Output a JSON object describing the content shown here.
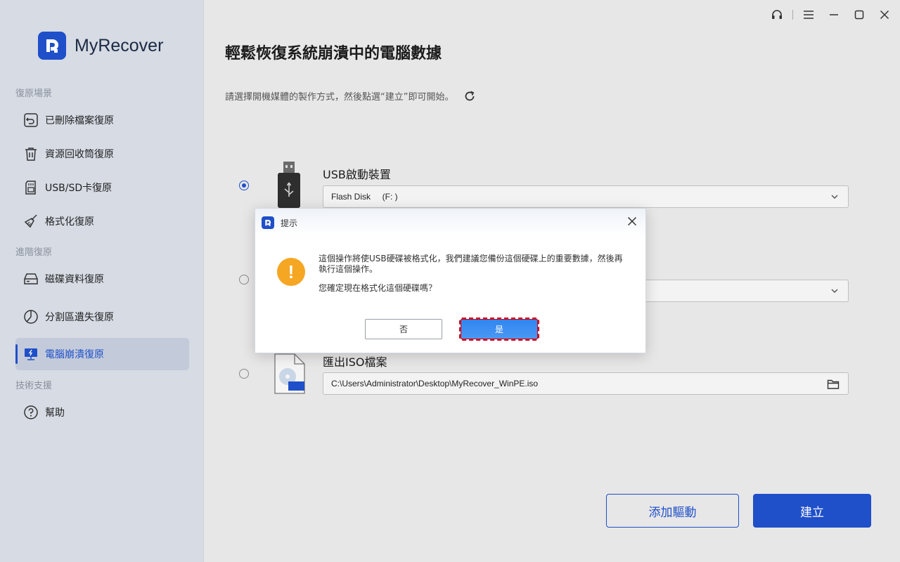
{
  "app": {
    "name": "MyRecover"
  },
  "sidebar": {
    "sections": [
      {
        "label": "復原場景"
      },
      {
        "label": "進階復原"
      },
      {
        "label": "技術支援"
      }
    ],
    "items": [
      {
        "label": "已刪除檔案復原",
        "icon": "restore-file-icon"
      },
      {
        "label": "資源回收筒復原",
        "icon": "trash-icon"
      },
      {
        "label": "USB/SD卡復原",
        "icon": "sd-card-icon"
      },
      {
        "label": "格式化復原",
        "icon": "broom-icon"
      },
      {
        "label": "磁碟資料復原",
        "icon": "hard-drive-icon"
      },
      {
        "label": "分割區遺失復原",
        "icon": "partition-icon"
      },
      {
        "label": "電腦崩潰復原",
        "icon": "crashed-pc-icon",
        "active": true
      },
      {
        "label": "幫助",
        "icon": "help-icon"
      }
    ]
  },
  "main": {
    "title": "輕鬆恢復系統崩潰中的電腦數據",
    "subtitle": "請選擇開機媒體的製作方式，然後點選“建立”即可開始。",
    "options": [
      {
        "title": "USB啟動裝置",
        "value": "Flash Disk     (F: )",
        "selected": true
      },
      {
        "title": "",
        "value": "",
        "selected": false
      },
      {
        "title": "匯出ISO檔案",
        "value": "C:\\Users\\Administrator\\Desktop\\MyRecover_WinPE.iso",
        "selected": false
      }
    ],
    "buttons": {
      "add_driver": "添加驅動",
      "create": "建立"
    }
  },
  "dialog": {
    "title": "提示",
    "message": "這個操作將使USB硬碟被格式化，我們建議您備份這個硬碟上的重要數據，然後再執行這個操作。",
    "question": "您確定現在格式化這個硬碟嗎？",
    "no_label": "否",
    "yes_label": "是"
  },
  "colors": {
    "accent": "#1f4fc9",
    "warning": "#f5a623",
    "sidebar_bg": "#d6dbe4"
  }
}
